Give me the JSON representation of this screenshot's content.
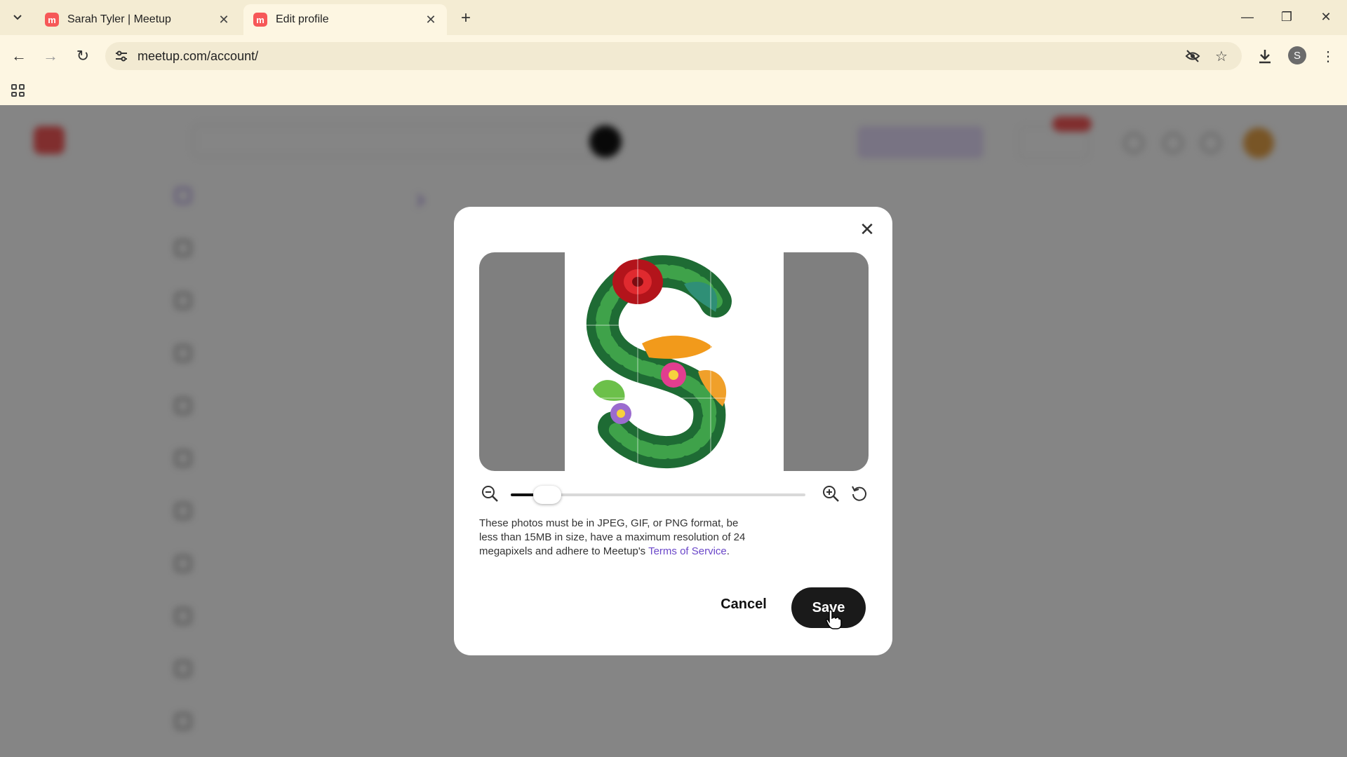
{
  "browser": {
    "tabs": [
      {
        "title": "Sarah Tyler | Meetup",
        "active": false
      },
      {
        "title": "Edit profile",
        "active": true
      }
    ],
    "url": "meetup.com/account/",
    "profile_initial": "S"
  },
  "modal": {
    "info_prefix": "These photos must be in JPEG, GIF, or PNG format, be less than 15MB in size, have a maximum resolution of 24 megapixels and adhere to Meetup's ",
    "terms_link": "Terms of Service",
    "info_suffix": ".",
    "cancel_label": "Cancel",
    "save_label": "Save",
    "zoom_level": 0.05
  },
  "colors": {
    "accent": "#6b47c9",
    "brand": "#f65858",
    "save_button": "#1a1a1a"
  }
}
